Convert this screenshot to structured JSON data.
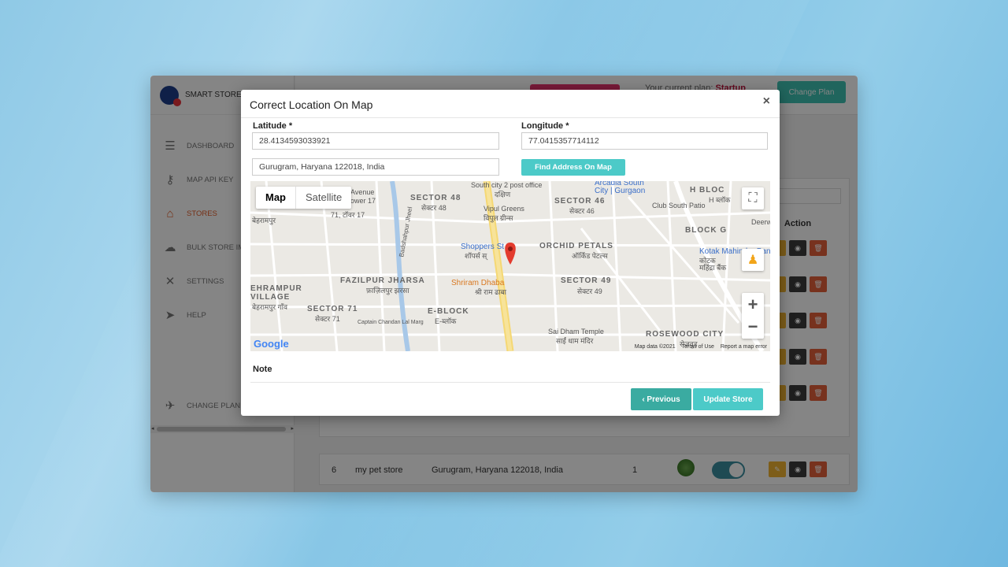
{
  "app": {
    "logo_text": "SMART STORE L",
    "plan_prefix": "Your current plan: ",
    "plan_name": "Startup",
    "change_plan_label": "Change Plan"
  },
  "sidebar": {
    "items": [
      {
        "label": "DASHBOARD",
        "icon": "dashboard-icon"
      },
      {
        "label": "MAP API KEY",
        "icon": "key-icon"
      },
      {
        "label": "STORES",
        "icon": "store-icon",
        "active": true
      },
      {
        "label": "BULK STORE IMI",
        "icon": "upload-icon"
      },
      {
        "label": "SETTINGS",
        "icon": "tools-icon"
      },
      {
        "label": "HELP",
        "icon": "send-icon"
      }
    ],
    "bottom_item": {
      "label": "CHANGE PLAN",
      "icon": "rocket-icon"
    }
  },
  "table": {
    "action_header": "Action",
    "last_row": {
      "index": "6",
      "name": "my pet store",
      "address": "Gurugram, Haryana 122018, India",
      "count": "1"
    }
  },
  "modal": {
    "title": "Correct Location On Map",
    "close": "×",
    "latitude_label": "Latitude *",
    "latitude_value": "28.4134593033921",
    "longitude_label": "Longitude *",
    "longitude_value": "77.0415357714112",
    "address_value": "Gurugram, Haryana 122018, India",
    "find_button": "Find Address On Map",
    "note_label": "Note",
    "previous_button": "‹ Previous",
    "update_button": "Update Store"
  },
  "map": {
    "type_map": "Map",
    "type_satellite": "Satellite",
    "labels": {
      "sector48": "SECTOR 48",
      "sector48_hi": "सेक्टर 48",
      "sector46": "SECTOR 46",
      "sector46_hi": "सेक्टर 46",
      "sector49": "SECTOR 49",
      "sector49_hi": "सेक्टर 49",
      "sector71": "SECTOR 71",
      "sector71_hi": "सेक्टर 71",
      "orchid": "ORCHID PETALS",
      "orchid_hi": "ऑर्किड पेटल्स",
      "fazilpur": "FAZILPUR JHARSA",
      "fazilpur_hi": "फ़ाज़िलपुर झरसा",
      "behrampur": "EHRAMPUR",
      "behrampur2": "VILLAGE",
      "behrampur_hi": "बेहरामपुर गाँव",
      "eblock": "E-BLOCK",
      "eblock_hi": "E-ब्लॉक",
      "blockg": "BLOCK G",
      "hbloc": "H BLOC",
      "hbloc_hi": "H ब्लॉक",
      "rosewood": "ROSEWOOD CITY",
      "rosewood_hi": "रोज़वुड",
      "post_office": "South city 2 post office",
      "post_office_hi": "दक्षिण",
      "arcadia": "Arcadia South",
      "arcadia2": "City | Gurgaon",
      "vipul": "Vipul Greens",
      "vipul_hi": "विपुल ग्रीन्स",
      "club": "Club South Patio",
      "shoppers": "Shoppers St",
      "shoppers_hi": "शॉपर्स स्",
      "shriram": "Shriram Dhaba",
      "shriram_hi": "श्री राम ढाबा",
      "kotak": "Kotak Mahindra Bank",
      "kotak_hi": "कोटक",
      "kotak_hi2": "महिंद्रा बैंक",
      "saidham": "Sai Dham Temple",
      "saidham_hi": "साईं धाम मंदिर",
      "avenue": "Avenue",
      "avenue2": "ower 17",
      "tower_hi": "71, टॉवर 17",
      "behrampur_short": "बेहरामपुर",
      "road_badshah": "Badshahpur Jheel",
      "road_captain": "Captain Chandan Lal Marg",
      "deerw": "Deerw"
    },
    "google": "Google",
    "map_data": "Map data ©2021",
    "terms": "Terms of Use",
    "report": "Report a map error"
  }
}
